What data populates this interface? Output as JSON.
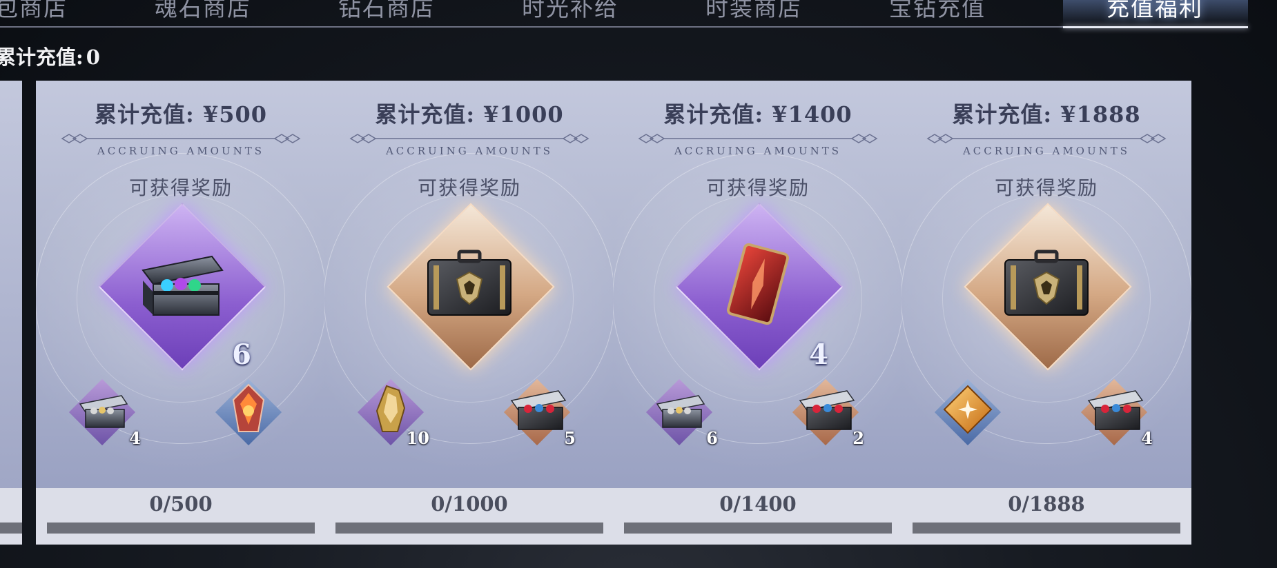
{
  "tabs": [
    {
      "label": "礼包商店",
      "active": false
    },
    {
      "label": "魂石商店",
      "active": false
    },
    {
      "label": "钻石商店",
      "active": false
    },
    {
      "label": "时光补给",
      "active": false
    },
    {
      "label": "时装商店",
      "active": false
    },
    {
      "label": "宝钻充值",
      "active": false
    },
    {
      "label": "充值福利",
      "active": true
    }
  ],
  "total": {
    "label": "累计充值:",
    "value": "0"
  },
  "card_subtitle": "ACCRUING AMOUNTS",
  "reward_label": "可获得奖励",
  "cards": [
    {
      "title": "累计充值: ¥500",
      "main": {
        "icon": "gem-chest-icon",
        "count": "6",
        "frame": "purple"
      },
      "left": {
        "icon": "silver-chest-icon",
        "count": "4",
        "frame": "purple"
      },
      "right": {
        "icon": "fire-crystal-icon",
        "count": "",
        "frame": "blue"
      },
      "progress_text": "0/500",
      "progress": 0
    },
    {
      "title": "累计充值: ¥1000",
      "main": {
        "icon": "black-case-icon",
        "count": "",
        "frame": "gold"
      },
      "left": {
        "icon": "gold-ore-icon",
        "count": "10",
        "frame": "purple"
      },
      "right": {
        "icon": "ruby-chest-icon",
        "count": "5",
        "frame": "orange"
      },
      "progress_text": "0/1000",
      "progress": 0
    },
    {
      "title": "累计充值: ¥1400",
      "main": {
        "icon": "red-card-icon",
        "count": "4",
        "frame": "purple"
      },
      "left": {
        "icon": "silver-chest-icon",
        "count": "6",
        "frame": "purple"
      },
      "right": {
        "icon": "ruby-chest-icon",
        "count": "2",
        "frame": "orange"
      },
      "progress_text": "0/1400",
      "progress": 0
    },
    {
      "title": "累计充值: ¥1888",
      "main": {
        "icon": "black-case-icon",
        "count": "",
        "frame": "gold"
      },
      "left": {
        "icon": "amber-star-icon",
        "count": "",
        "frame": "blue"
      },
      "right": {
        "icon": "ruby-chest-icon",
        "count": "4",
        "frame": "orange"
      },
      "progress_text": "0/1888",
      "progress": 0
    }
  ],
  "colors": {
    "progress_track": "#6e7079",
    "active_tab": "#ffffff",
    "inactive_tab": "#8f93a3"
  }
}
